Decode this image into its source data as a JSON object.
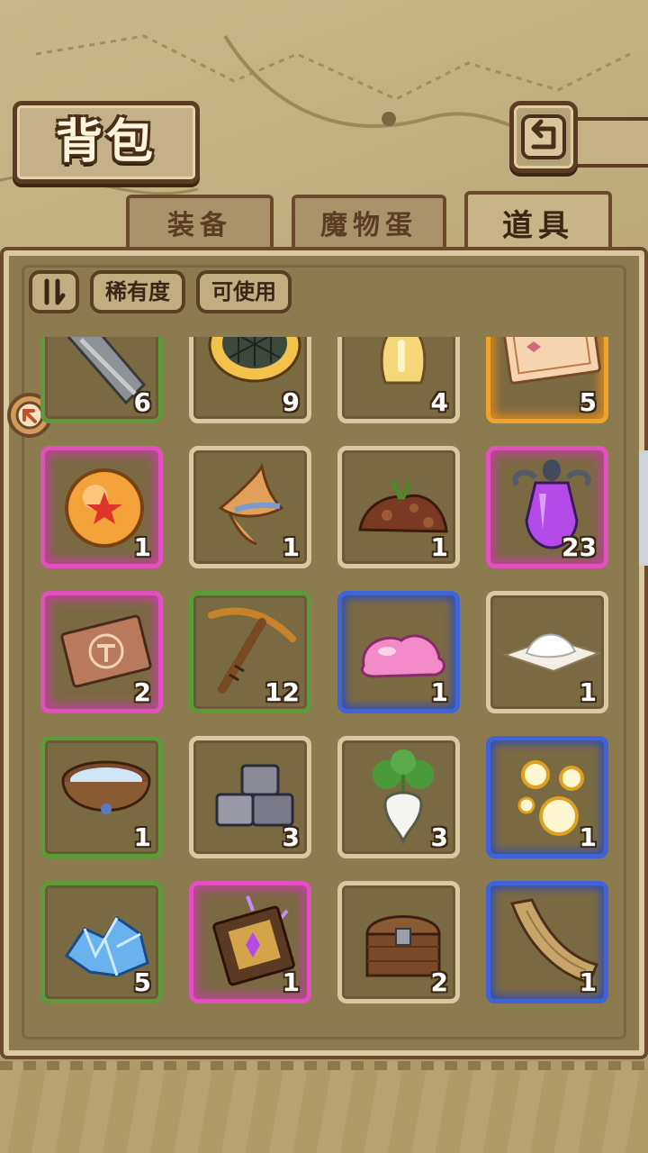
{
  "header": {
    "title": "背包"
  },
  "tabs": [
    {
      "label": "装备",
      "active": false
    },
    {
      "label": "魔物蛋",
      "active": false
    },
    {
      "label": "道具",
      "active": true
    }
  ],
  "filters": {
    "sort_icon": "sort-toggle-icon",
    "rarity_label": "稀有度",
    "usable_label": "可使用"
  },
  "rarity_colors": {
    "common": "#d9c9a1",
    "uncommon": "#5c9a3a",
    "rare": "#3f63d8",
    "epic": "#e24fbf",
    "legendary": "#f0a52a"
  },
  "items": [
    {
      "name": "iron-blade",
      "qty": "6",
      "rarity": "uncommon"
    },
    {
      "name": "pie",
      "qty": "9",
      "rarity": "common"
    },
    {
      "name": "potion-bottle",
      "qty": "4",
      "rarity": "common"
    },
    {
      "name": "ticket",
      "qty": "5",
      "rarity": "legendary"
    },
    {
      "name": "star-orb",
      "qty": "1",
      "rarity": "epic"
    },
    {
      "name": "wizard-hat",
      "qty": "1",
      "rarity": "common"
    },
    {
      "name": "dirt-pile",
      "qty": "1",
      "rarity": "common"
    },
    {
      "name": "purple-elixir",
      "qty": "23",
      "rarity": "epic"
    },
    {
      "name": "rune-card",
      "qty": "2",
      "rarity": "epic"
    },
    {
      "name": "pickaxe",
      "qty": "12",
      "rarity": "uncommon"
    },
    {
      "name": "pink-slime",
      "qty": "1",
      "rarity": "rare"
    },
    {
      "name": "flour-pile",
      "qty": "1",
      "rarity": "common"
    },
    {
      "name": "water-bowl",
      "qty": "1",
      "rarity": "uncommon"
    },
    {
      "name": "stone-blocks",
      "qty": "3",
      "rarity": "common"
    },
    {
      "name": "turnip",
      "qty": "3",
      "rarity": "common"
    },
    {
      "name": "golden-orbs",
      "qty": "1",
      "rarity": "rare"
    },
    {
      "name": "ice-crystals",
      "qty": "5",
      "rarity": "uncommon"
    },
    {
      "name": "magic-tome",
      "qty": "1",
      "rarity": "epic"
    },
    {
      "name": "treasure-chest",
      "qty": "2",
      "rarity": "common"
    },
    {
      "name": "wood-plank",
      "qty": "1",
      "rarity": "rare"
    }
  ]
}
